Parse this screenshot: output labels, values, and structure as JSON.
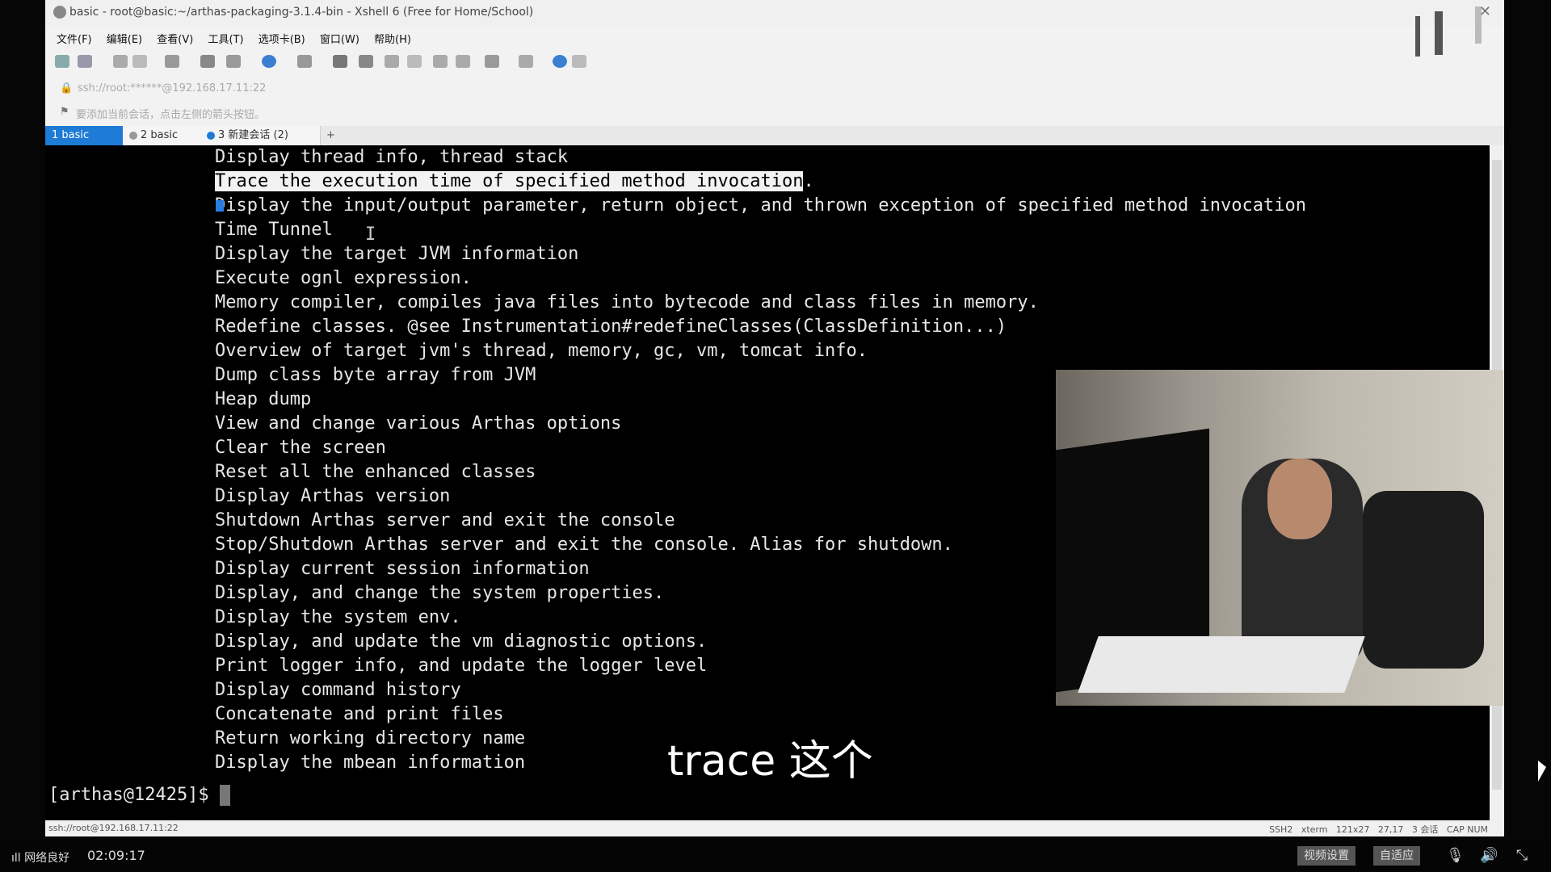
{
  "window": {
    "title": "basic - root@basic:~/arthas-packaging-3.1.4-bin - Xshell 6 (Free for Home/School)"
  },
  "menu": [
    "文件(F)",
    "编辑(E)",
    "查看(V)",
    "工具(T)",
    "选项卡(B)",
    "窗口(W)",
    "帮助(H)"
  ],
  "address": {
    "text": "ssh://root:******@192.168.17.11:22"
  },
  "notice": {
    "text": "要添加当前会话，点击左侧的箭头按钮。"
  },
  "tabs": [
    {
      "label": "1 basic"
    },
    {
      "label": "2 basic"
    },
    {
      "label": "3 新建会话 (2)"
    }
  ],
  "tab_add": "+",
  "terminal": {
    "lines": [
      "Display thread info, thread stack",
      "Trace the execution time of specified method invocation.",
      "Display the input/output parameter, return object, and thrown exception of specified method invocation",
      "Time Tunnel",
      "Display the target JVM information",
      "Execute ognl expression.",
      "Memory compiler, compiles java files into bytecode and class files in memory.",
      "Redefine classes. @see Instrumentation#redefineClasses(ClassDefinition...)",
      "Overview of target jvm's thread, memory, gc, vm, tomcat info.",
      "Dump class byte array from JVM",
      "Heap dump",
      "View and change various Arthas options",
      "Clear the screen",
      "Reset all the enhanced classes",
      "Display Arthas version",
      "Shutdown Arthas server and exit the console",
      "Stop/Shutdown Arthas server and exit the console. Alias for shutdown.",
      "Display current session information",
      "Display, and change the system properties.",
      "Display the system env.",
      "Display, and update the vm diagnostic options.",
      "Print logger info, and update the logger level",
      "Display command history",
      "Concatenate and print files",
      "Return working directory name",
      "Display the mbean information"
    ],
    "highlighted": "Trace the execution time of specified method invocation",
    "highlighted_tail": ".",
    "prompt": "[arthas@12425]$ "
  },
  "statusbar": {
    "left": "ssh://root@192.168.17.11:22",
    "right": "SSH2   xterm   121x27   27,17   3 会话   CAP NUM"
  },
  "subtitle": "trace 这个",
  "taskbar": {
    "network": "网络良好",
    "time": "02:09:17",
    "btn1": "视频设置",
    "btn2": "自适应"
  },
  "colors": {
    "tab_active": "#1e7bd6",
    "terminal_bg": "#000000",
    "terminal_fg": "#e6e6e6"
  }
}
